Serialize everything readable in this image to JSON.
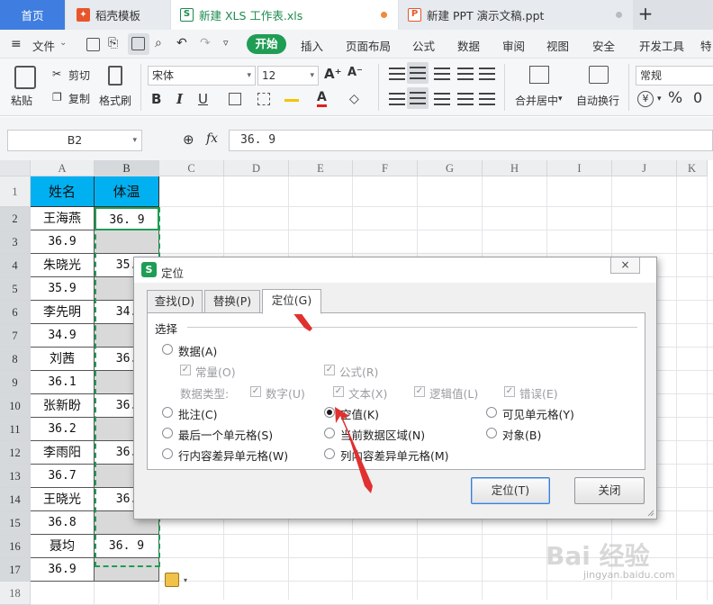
{
  "tabs": {
    "home": "首页",
    "t1": "稻壳模板",
    "t2": "新建 XLS 工作表.xls",
    "t3": "新建 PPT 演示文稿.ppt",
    "plus": "+"
  },
  "menubar": {
    "file": "文件",
    "start": "开始",
    "items": [
      "插入",
      "页面布局",
      "公式",
      "数据",
      "审阅",
      "视图",
      "安全",
      "开发工具"
    ],
    "extra": "特"
  },
  "ribbon": {
    "paste": "粘贴",
    "cut": "剪切",
    "copy": "复制",
    "format_painter": "格式刷",
    "font_name": "宋体",
    "font_size": "12",
    "bold": "B",
    "italic": "I",
    "underline": "U",
    "merge": "合并居中",
    "wrap": "自动换行",
    "number_format": "常规",
    "percent": "%",
    "currency": "¥",
    "thousands": "0"
  },
  "formula_bar": {
    "name_box": "B2",
    "fx": "fx",
    "value": "36. 9"
  },
  "grid": {
    "columns": [
      "A",
      "B",
      "C",
      "D",
      "E",
      "F",
      "G",
      "H",
      "I",
      "J",
      "K"
    ],
    "rows": [
      "1",
      "2",
      "3",
      "4",
      "5",
      "6",
      "7",
      "8",
      "9",
      "10",
      "11",
      "12",
      "13",
      "14",
      "15",
      "16",
      "17",
      "18"
    ],
    "header_a": "姓名",
    "header_b": "体温",
    "col_a": [
      "王海燕",
      "36.9",
      "朱晓光",
      "35.9",
      "李先明",
      "34.9",
      "刘茜",
      "36.1",
      "张新盼",
      "36.2",
      "李雨阳",
      "36.7",
      "王晓光",
      "36.8",
      "聂均",
      "36.9"
    ],
    "col_b": [
      "36. 9",
      "",
      "35.",
      "",
      "34.",
      "",
      "36.",
      "",
      "36.",
      "",
      "36.",
      "",
      "36.",
      "",
      "36. 9",
      ""
    ]
  },
  "dialog": {
    "title": "定位",
    "close": "×",
    "tab_find": "查找(D)",
    "tab_replace": "替换(P)",
    "tab_goto": "定位(G)",
    "section": "选择",
    "opt_data": "数据(A)",
    "chk_constant": "常量(O)",
    "chk_formula": "公式(R)",
    "data_type": "数据类型:",
    "chk_number": "数字(U)",
    "chk_text": "文本(X)",
    "chk_logic": "逻辑值(L)",
    "chk_error": "错误(E)",
    "opt_comment": "批注(C)",
    "opt_null": "空值(K)",
    "opt_visible": "可见单元格(Y)",
    "opt_last": "最后一个单元格(S)",
    "opt_region": "当前数据区域(N)",
    "opt_object": "对象(B)",
    "opt_rowdiff": "行内容差异单元格(W)",
    "opt_coldiff": "列内容差异单元格(M)",
    "btn_goto": "定位(T)",
    "btn_close": "关闭"
  },
  "watermark": {
    "text": "Bai 经验",
    "url": "jingyan.baidu.com"
  },
  "colors": {
    "accent_green": "#1f9d55",
    "header_cyan": "#00b0f0",
    "arrow_red": "#e03030",
    "home_blue": "#3f7ee0"
  }
}
